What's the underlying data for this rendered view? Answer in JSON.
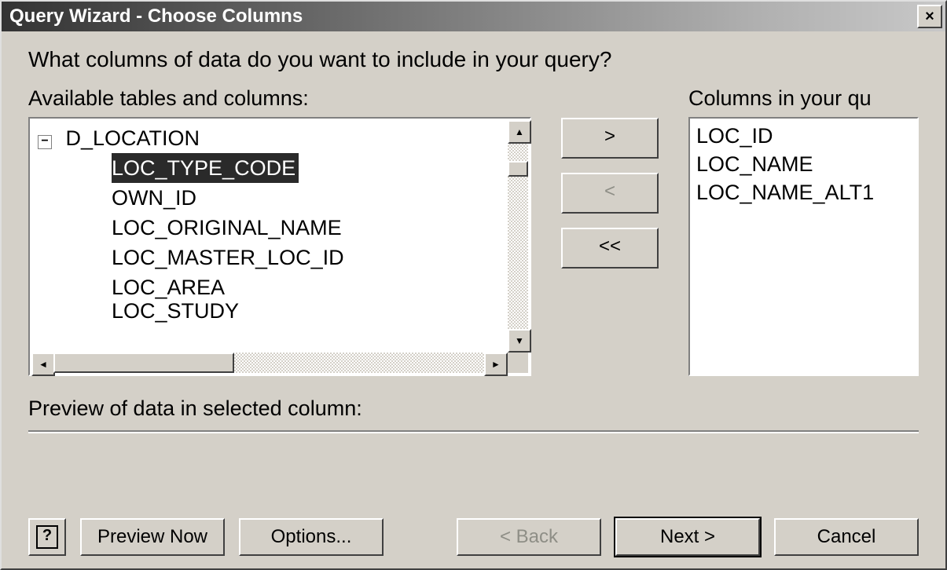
{
  "titlebar": {
    "title": "Query Wizard - Choose Columns",
    "close_icon": "×"
  },
  "prompt": "What columns of data do you want to include in your query?",
  "labels": {
    "available": "Available tables and columns:",
    "selected": "Columns in your qu",
    "preview": "Preview of data in selected column:"
  },
  "available_tree": {
    "table_name": "D_LOCATION",
    "expand_symbol": "−",
    "columns": [
      "LOC_TYPE_CODE",
      "OWN_ID",
      "LOC_ORIGINAL_NAME",
      "LOC_MASTER_LOC_ID",
      "LOC_AREA",
      "LOC_STUDY"
    ],
    "selected_index": 0
  },
  "selected_columns": [
    "LOC_ID",
    "LOC_NAME",
    "LOC_NAME_ALT1"
  ],
  "move_buttons": {
    "add": ">",
    "remove": "<",
    "remove_all": "<<"
  },
  "scroll": {
    "up": "▲",
    "down": "▼",
    "left": "◄",
    "right": "►"
  },
  "footer": {
    "help": "?",
    "preview_now": "Preview Now",
    "options": "Options...",
    "back": "< Back",
    "next": "Next >",
    "cancel": "Cancel"
  }
}
